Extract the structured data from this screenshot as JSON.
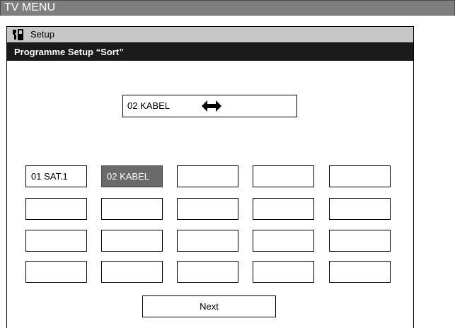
{
  "titlebar": {
    "title": "TV MENU"
  },
  "setup_bar": {
    "label": "Setup",
    "icon": "tool-icon"
  },
  "section": {
    "title": "Programme Setup “Sort”"
  },
  "current": {
    "label": "02  KABEL",
    "icon": "swap-arrows-icon"
  },
  "grid": {
    "rows": [
      [
        "01  SAT.1",
        "02  KABEL",
        "",
        "",
        ""
      ],
      [
        "",
        "",
        "",
        "",
        ""
      ],
      [
        "",
        "",
        "",
        "",
        ""
      ],
      [
        "",
        "",
        "",
        "",
        ""
      ]
    ],
    "selected": [
      0,
      1
    ],
    "selected_color": "#6a6a6a"
  },
  "next": {
    "label": "Next"
  }
}
